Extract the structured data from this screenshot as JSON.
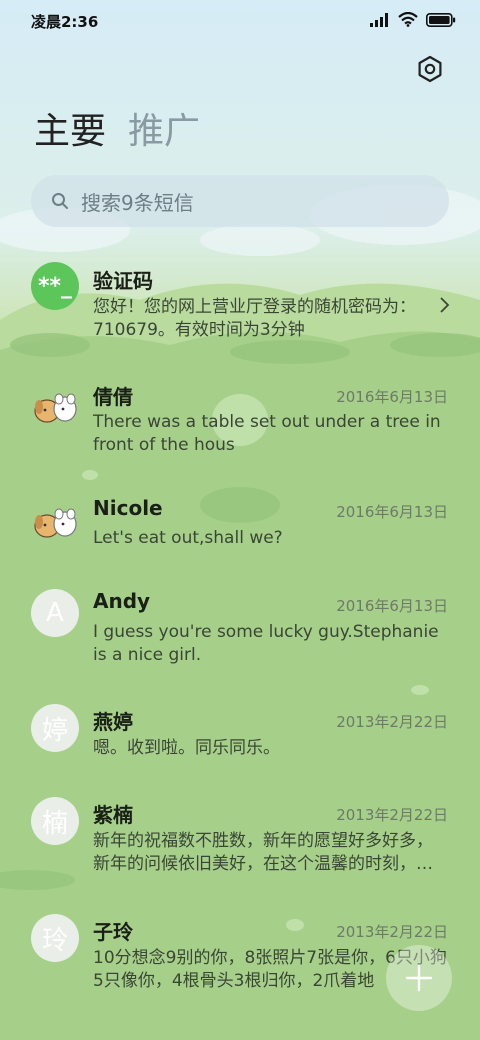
{
  "status": {
    "time": "凌晨2:36",
    "icons": [
      "signal-icon",
      "wifi-icon",
      "battery-icon"
    ]
  },
  "header": {
    "settings_icon": "gear-icon"
  },
  "tabs": [
    {
      "label": "主要"
    },
    {
      "label": "推广"
    }
  ],
  "search": {
    "placeholder": "搜索9条短信"
  },
  "messages": [
    {
      "name": "验证码",
      "avatar_text": "**_",
      "date": "",
      "text": "您好！您的网上营业厅登录的随机密码为：710679。有效时间为3分钟"
    },
    {
      "name": "倩倩",
      "avatar_text": "",
      "date": "2016年6月13日",
      "text": "There was a table set out under a tree in front of the hous"
    },
    {
      "name": "Nicole",
      "avatar_text": "",
      "date": "2016年6月13日",
      "text": "Let's eat out,shall we?"
    },
    {
      "name": "Andy",
      "avatar_text": "A",
      "date": "2016年6月13日",
      "text": "I guess you're some lucky guy.Stephanie is a nice girl."
    },
    {
      "name": "燕婷",
      "avatar_text": "婷",
      "date": "2013年2月22日",
      "text": "嗯。收到啦。同乐同乐。"
    },
    {
      "name": "紫楠",
      "avatar_text": "楠",
      "date": "2013年2月22日",
      "text": "新年的祝福数不胜数，新年的愿望好多好多，新年的问候依旧美好，在这个温馨的时刻，…"
    },
    {
      "name": "子玲",
      "avatar_text": "玲",
      "date": "2013年2月22日",
      "text": "10分想念9别的你，8张照片7张是你，6只小狗5只像你，4根骨头3根归你，2爪着地"
    }
  ],
  "fab": {
    "icon": "plus-icon"
  },
  "colors": {
    "accent_green": "#5cc65b",
    "meadow": "#a8d28b",
    "sky": "#d6ecf6"
  }
}
